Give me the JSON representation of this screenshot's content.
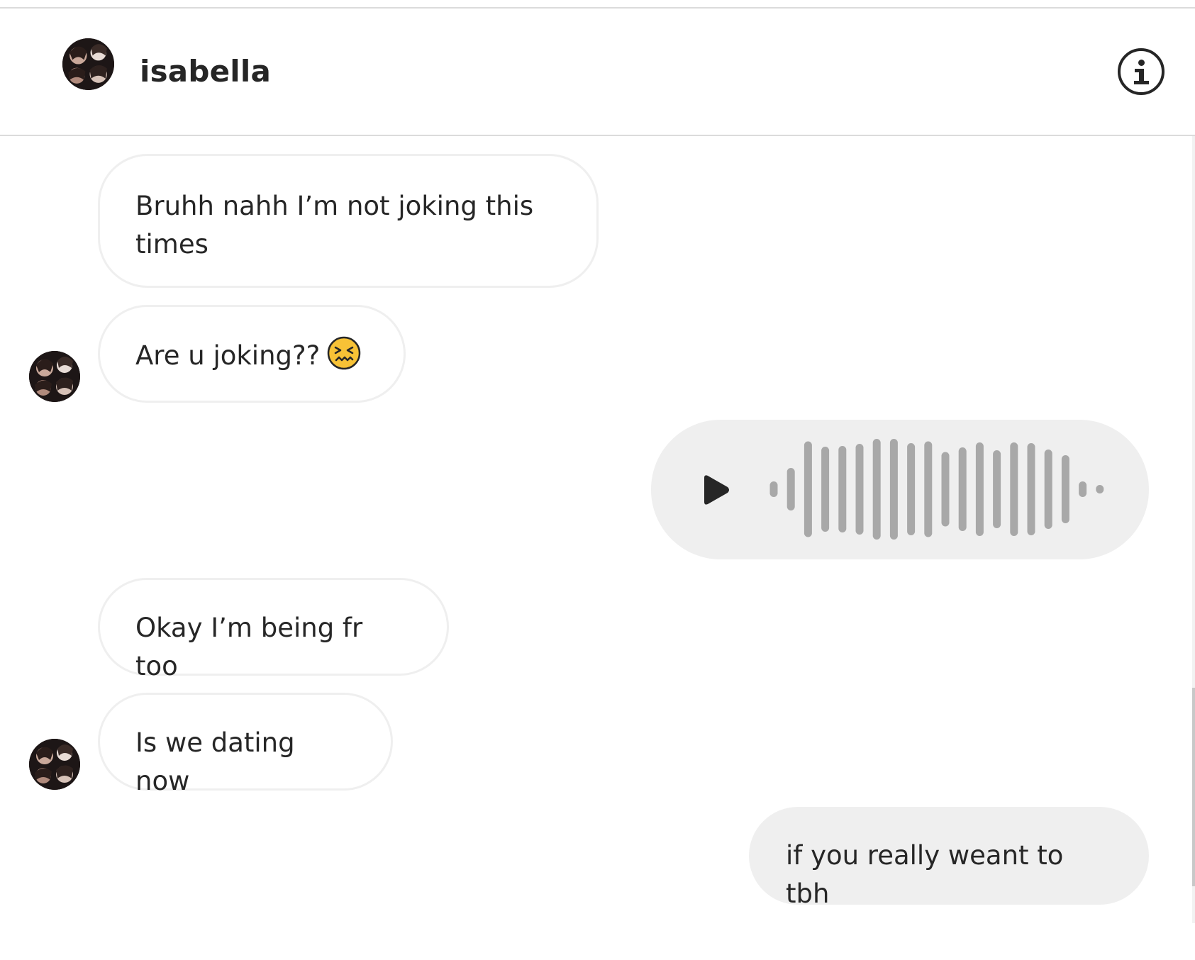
{
  "header": {
    "name": "isabella"
  },
  "messages": [
    {
      "id": "m1",
      "direction": "in",
      "text": "Bruhh nahh I’m not joking this\ntimes"
    },
    {
      "id": "m2",
      "direction": "in",
      "text": "Are u joking??",
      "emoji": "confounded-face-emoji"
    },
    {
      "id": "m3",
      "direction": "out",
      "type": "voice"
    },
    {
      "id": "m4",
      "direction": "in",
      "text": "Okay I’m being fr too"
    },
    {
      "id": "m5",
      "direction": "in",
      "text": "Is we dating now"
    },
    {
      "id": "m6",
      "direction": "out",
      "text": "if you really weant to tbh"
    }
  ],
  "colors": {
    "incoming_bubble": "#ffffff",
    "incoming_border": "#efefef",
    "outgoing_bubble": "#efefef",
    "text": "#262626",
    "waveform": "#a8a8a8"
  },
  "icons": {
    "info": "info-icon",
    "play": "play-icon"
  }
}
